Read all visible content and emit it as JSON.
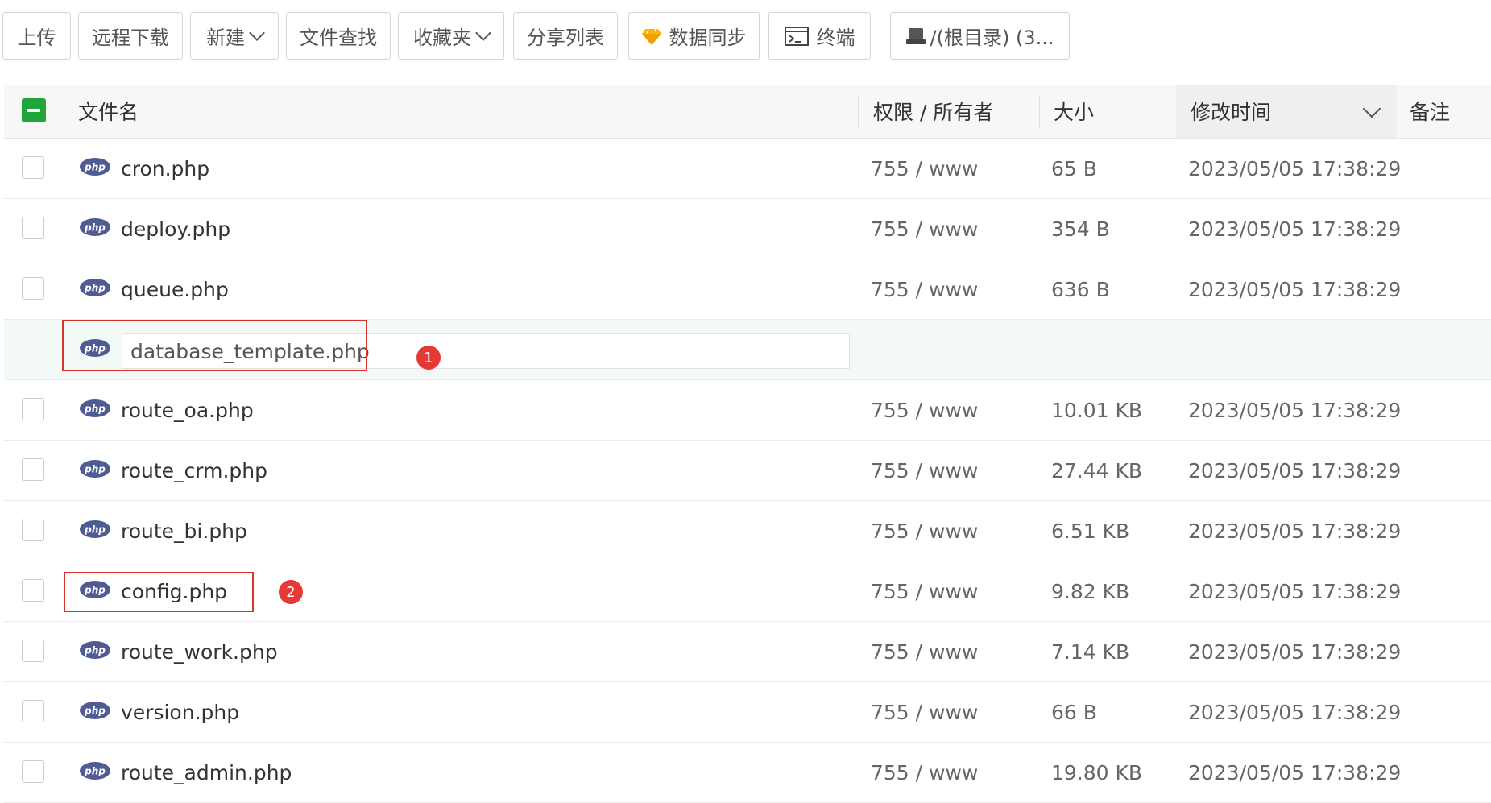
{
  "toolbar": {
    "upload": "上传",
    "remote_download": "远程下载",
    "new": "新建",
    "file_search": "文件查找",
    "favorites": "收藏夹",
    "share_list": "分享列表",
    "data_sync": "数据同步",
    "terminal": "终端",
    "root_path": "/(根目录) (3..."
  },
  "table": {
    "headers": {
      "filename": "文件名",
      "perm_owner": "权限 / 所有者",
      "size": "大小",
      "modified": "修改时间",
      "note": "备注"
    },
    "rows": [
      {
        "name": "cron.php",
        "perm": "755 / www",
        "size": "65 B",
        "mtime": "2023/05/05 17:38:29"
      },
      {
        "name": "deploy.php",
        "perm": "755 / www",
        "size": "354 B",
        "mtime": "2023/05/05 17:38:29"
      },
      {
        "name": "queue.php",
        "perm": "755 / www",
        "size": "636 B",
        "mtime": "2023/05/05 17:38:29"
      },
      {
        "name": "route_oa.php",
        "perm": "755 / www",
        "size": "10.01 KB",
        "mtime": "2023/05/05 17:38:29"
      },
      {
        "name": "route_crm.php",
        "perm": "755 / www",
        "size": "27.44 KB",
        "mtime": "2023/05/05 17:38:29"
      },
      {
        "name": "route_bi.php",
        "perm": "755 / www",
        "size": "6.51 KB",
        "mtime": "2023/05/05 17:38:29"
      },
      {
        "name": "config.php",
        "perm": "755 / www",
        "size": "9.82 KB",
        "mtime": "2023/05/05 17:38:29"
      },
      {
        "name": "route_work.php",
        "perm": "755 / www",
        "size": "7.14 KB",
        "mtime": "2023/05/05 17:38:29"
      },
      {
        "name": "version.php",
        "perm": "755 / www",
        "size": "66 B",
        "mtime": "2023/05/05 17:38:29"
      },
      {
        "name": "route_admin.php",
        "perm": "755 / www",
        "size": "19.80 KB",
        "mtime": "2023/05/05 17:38:29"
      }
    ],
    "editing_row": {
      "value": "database_template.php"
    }
  },
  "annotations": {
    "badge1": "1",
    "badge2": "2"
  },
  "colors": {
    "accent_green": "#20a53a",
    "annotation_red": "#d9342b",
    "php_icon": "#4f5b93"
  }
}
